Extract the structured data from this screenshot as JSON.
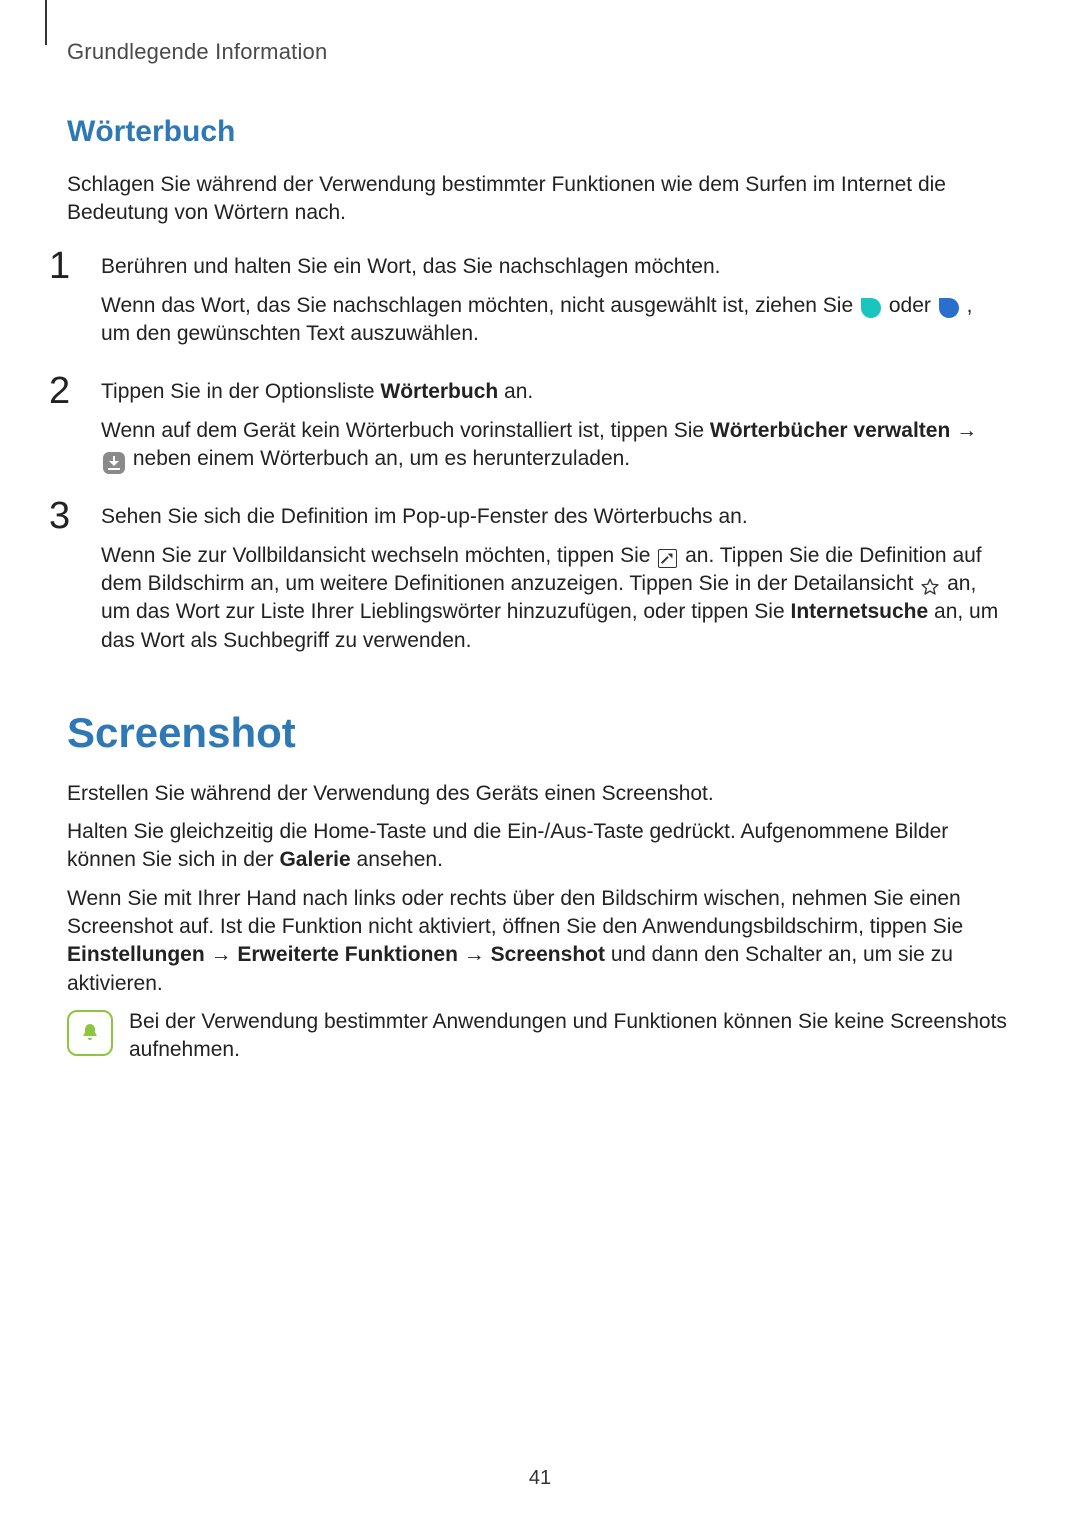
{
  "running_head": "Grundlegende Information",
  "page_number": "41",
  "s1": {
    "title": "Wörterbuch",
    "intro": "Schlagen Sie während der Verwendung bestimmter Funktionen wie dem Surfen im Internet die Bedeutung von Wörtern nach.",
    "step1": {
      "num": "1",
      "a": "Berühren und halten Sie ein Wort, das Sie nachschlagen möchten.",
      "b1": "Wenn das Wort, das Sie nachschlagen möchten, nicht ausgewählt ist, ziehen Sie ",
      "b_oder": " oder ",
      "b2": ", um den gewünschten Text auszuwählen."
    },
    "step2": {
      "num": "2",
      "a1": "Tippen Sie in der Optionsliste ",
      "a_bold": "Wörterbuch",
      "a2": " an.",
      "b1": "Wenn auf dem Gerät kein Wörterbuch vorinstalliert ist, tippen Sie ",
      "b_bold": "Wörterbücher verwalten",
      "b_arrow": " → ",
      "b2": " neben einem Wörterbuch an, um es herunterzuladen."
    },
    "step3": {
      "num": "3",
      "a": "Sehen Sie sich die Definition im Pop-up-Fenster des Wörterbuchs an.",
      "b1": "Wenn Sie zur Vollbildansicht wechseln möchten, tippen Sie ",
      "b2": " an. Tippen Sie die Definition auf dem Bildschirm an, um weitere Definitionen anzuzeigen. Tippen Sie in der Detailansicht ",
      "b3": " an, um das Wort zur Liste Ihrer Lieblingswörter hinzuzufügen, oder tippen Sie ",
      "b_bold": "Internetsuche",
      "b4": " an, um das Wort als Suchbegriff zu verwenden."
    }
  },
  "s2": {
    "title": "Screenshot",
    "p1": "Erstellen Sie während der Verwendung des Geräts einen Screenshot.",
    "p2a": "Halten Sie gleichzeitig die Home-Taste und die Ein-/Aus-Taste gedrückt. Aufgenommene Bilder können Sie sich in der ",
    "p2_bold": "Galerie",
    "p2b": " ansehen.",
    "p3a": "Wenn Sie mit Ihrer Hand nach links oder rechts über den Bildschirm wischen, nehmen Sie einen Screenshot auf. Ist die Funktion nicht aktiviert, öffnen Sie den Anwendungsbildschirm, tippen Sie ",
    "p3_b1": "Einstellungen",
    "p3_ar1": " → ",
    "p3_b2": "Erweiterte Funktionen",
    "p3_ar2": " → ",
    "p3_b3": "Screenshot",
    "p3b": " und dann den Schalter an, um sie zu aktivieren.",
    "note": "Bei der Verwendung bestimmter Anwendungen und Funktionen können Sie keine Screenshots aufnehmen."
  }
}
